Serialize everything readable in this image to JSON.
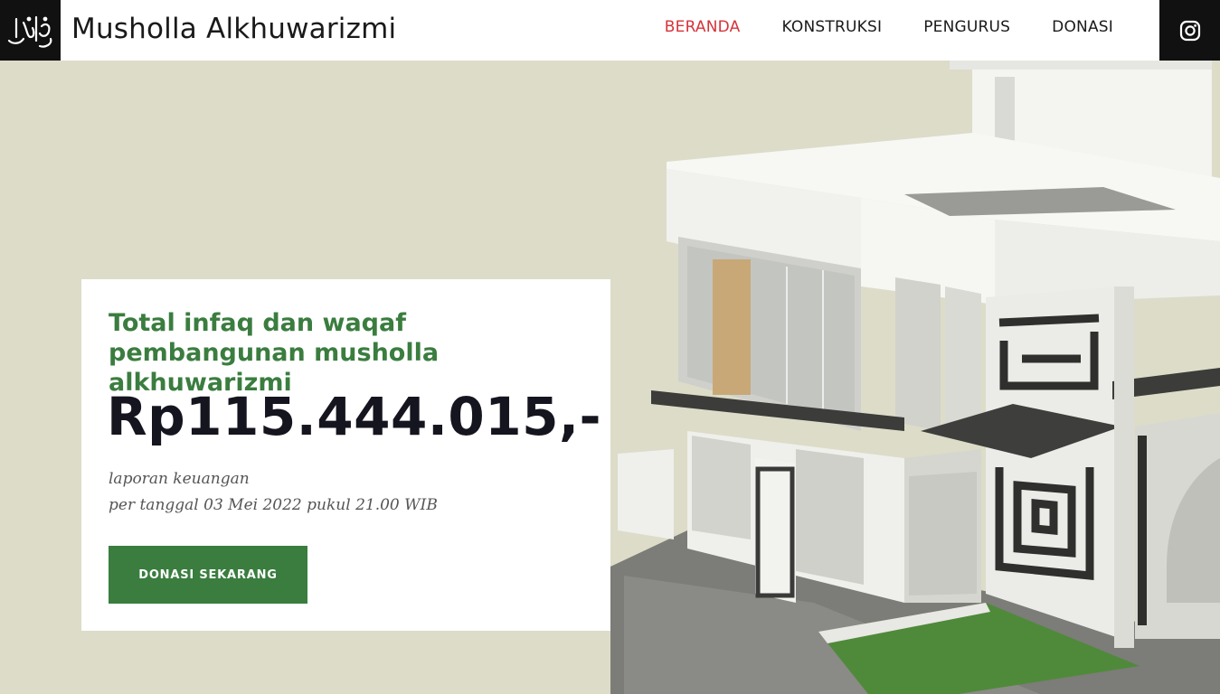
{
  "header": {
    "logo_alt": "الخوارزمي",
    "site_title": "Musholla Alkhuwarizmi",
    "nav": [
      {
        "label": "BERANDA",
        "active": true
      },
      {
        "label": "KONSTRUKSI",
        "active": false
      },
      {
        "label": "PENGURUS",
        "active": false
      },
      {
        "label": "DONASI",
        "active": false
      }
    ],
    "social_icon": "instagram-icon"
  },
  "hero": {
    "card": {
      "title": "Total infaq dan waqaf pembangunan musholla alkhuwarizmi",
      "amount": "Rp115.444.015,-",
      "report_line1": "laporan keuangan",
      "report_line2": "per tanggal 03 Mei 2022 pukul 21.00 WIB",
      "button_label": "DONASI SEKARANG"
    }
  },
  "colors": {
    "accent_green": "#3a7d3f",
    "active_red": "#d6333a",
    "header_bg": "#ffffff",
    "dark_box": "#111111",
    "hero_bg": "#dcdcc9"
  }
}
